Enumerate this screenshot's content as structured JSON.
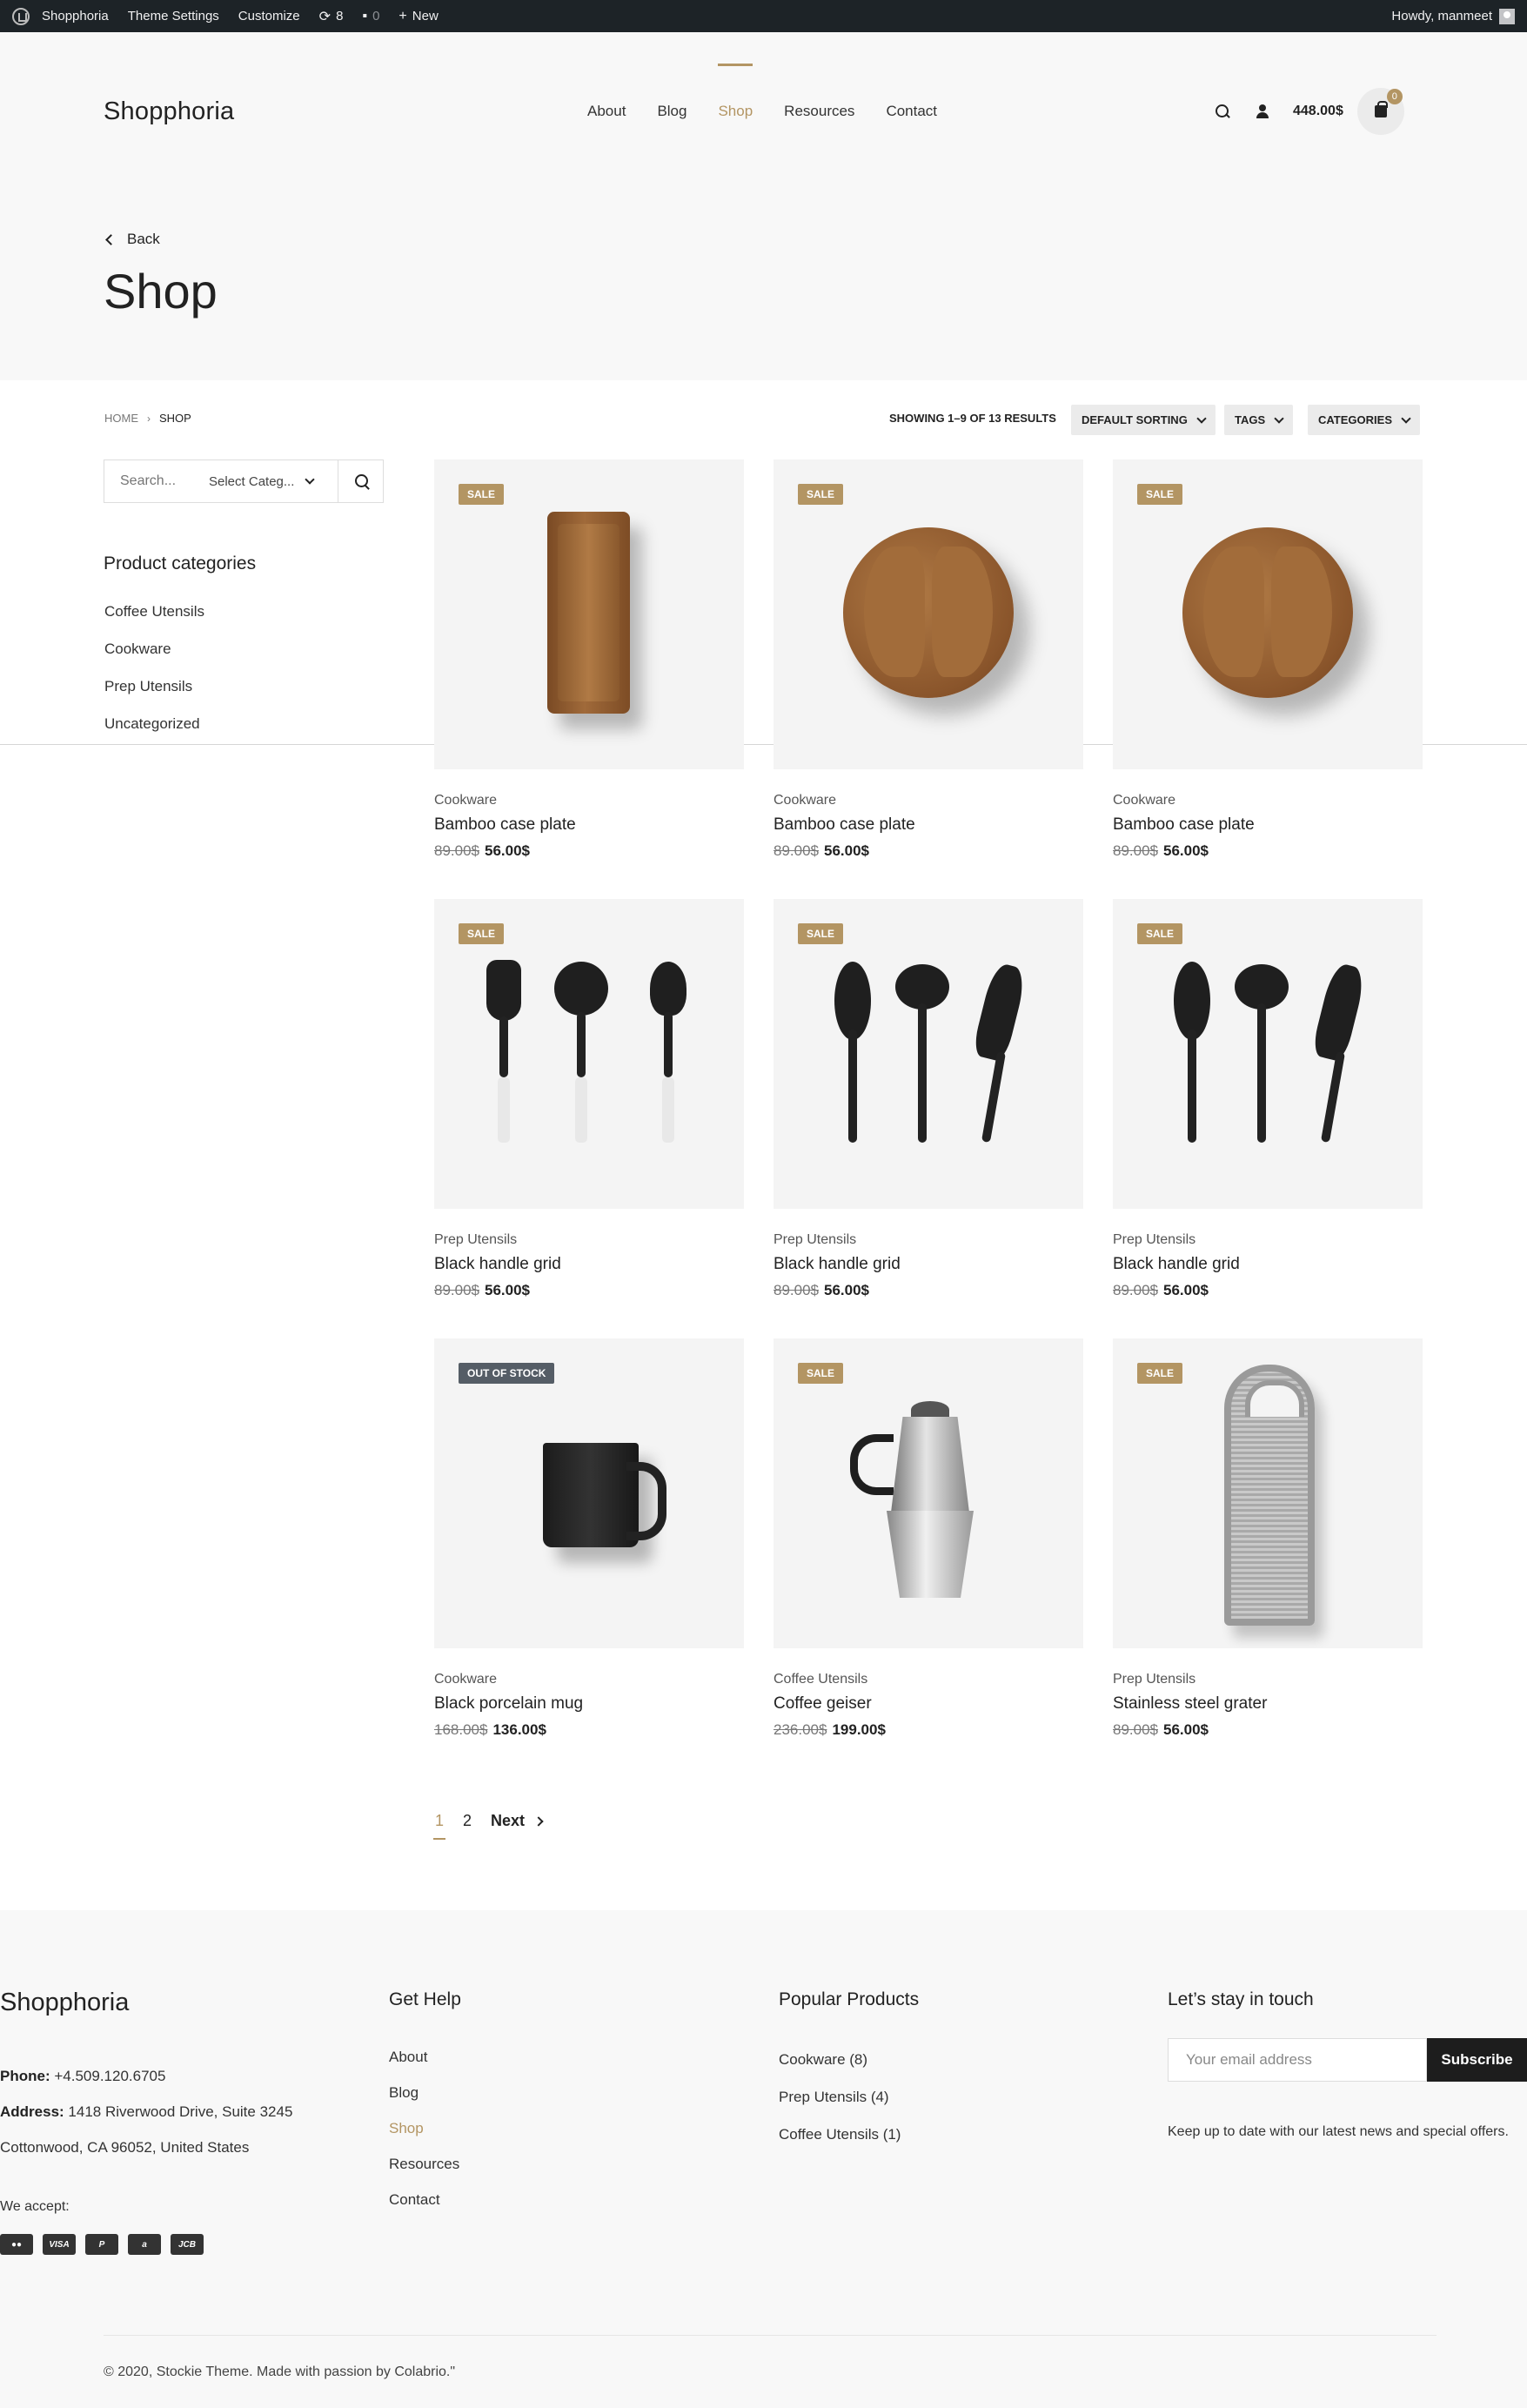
{
  "adminbar": {
    "site": "Shopphoria",
    "theme_settings": "Theme Settings",
    "customize": "Customize",
    "updates_count": "8",
    "comments_count": "0",
    "new_label": "New",
    "howdy": "Howdy, manmeet"
  },
  "header": {
    "logo": "Shopphoria",
    "nav": [
      "About",
      "Blog",
      "Shop",
      "Resources",
      "Contact"
    ],
    "active_nav": "Shop",
    "cart_total": "448.00$",
    "cart_count": "0"
  },
  "page": {
    "back_label": "Back",
    "title": "Shop"
  },
  "toolbar": {
    "breadcrumb": [
      "HOME",
      "SHOP"
    ],
    "results": "SHOWING 1–9 OF 13 RESULTS",
    "sorting": "DEFAULT SORTING",
    "tags": "TAGS",
    "categories": "CATEGORIES"
  },
  "sidebar": {
    "search_placeholder": "Search...",
    "category_select": "Select Categ...",
    "title": "Product categories",
    "categories": [
      "Coffee Utensils",
      "Cookware",
      "Prep Utensils",
      "Uncategorized"
    ]
  },
  "products": [
    {
      "badge": "SALE",
      "category": "Cookware",
      "title": "Bamboo case plate",
      "old_price": "89.00$",
      "price": "56.00$",
      "image": "wooden-tray"
    },
    {
      "badge": "SALE",
      "category": "Cookware",
      "title": "Bamboo case plate",
      "old_price": "89.00$",
      "price": "56.00$",
      "image": "wooden-bowl"
    },
    {
      "badge": "SALE",
      "category": "Cookware",
      "title": "Bamboo case plate",
      "old_price": "89.00$",
      "price": "56.00$",
      "image": "wooden-bowl"
    },
    {
      "badge": "SALE",
      "category": "Prep Utensils",
      "title": "Black handle grid",
      "old_price": "89.00$",
      "price": "56.00$",
      "image": "utensils-white-handle"
    },
    {
      "badge": "SALE",
      "category": "Prep Utensils",
      "title": "Black handle grid",
      "old_price": "89.00$",
      "price": "56.00$",
      "image": "utensils-black"
    },
    {
      "badge": "SALE",
      "category": "Prep Utensils",
      "title": "Black handle grid",
      "old_price": "89.00$",
      "price": "56.00$",
      "image": "utensils-black"
    },
    {
      "badge": "OUT OF STOCK",
      "category": "Cookware",
      "title": "Black porcelain mug",
      "old_price": "168.00$",
      "price": "136.00$",
      "image": "black-mug"
    },
    {
      "badge": "SALE",
      "category": "Coffee Utensils",
      "title": "Coffee geiser",
      "old_price": "236.00$",
      "price": "199.00$",
      "image": "moka-pot"
    },
    {
      "badge": "SALE",
      "category": "Prep Utensils",
      "title": "Stainless steel grater",
      "old_price": "89.00$",
      "price": "56.00$",
      "image": "grater"
    }
  ],
  "pagination": {
    "pages": [
      "1",
      "2"
    ],
    "current": "1",
    "next": "Next"
  },
  "footer": {
    "logo": "Shopphoria",
    "phone_label": "Phone:",
    "phone": "+4.509.120.6705",
    "address_label": "Address:",
    "address_line1": "1418 Riverwood Drive, Suite 3245",
    "address_line2": "Cottonwood, CA 96052, United States",
    "we_accept": "We accept:",
    "payments": [
      "mastercard-icon",
      "visa-icon",
      "paypal-icon",
      "amazon-icon",
      "jcb-icon"
    ],
    "payment_labels": [
      "",
      "VISA",
      "P",
      "a",
      "JCB"
    ],
    "help_title": "Get Help",
    "help_links": [
      "About",
      "Blog",
      "Shop",
      "Resources",
      "Contact"
    ],
    "popular_title": "Popular Products",
    "popular_links": [
      "Cookware (8)",
      "Prep Utensils (4)",
      "Coffee Utensils (1)"
    ],
    "touch_title": "Let’s stay in touch",
    "email_placeholder": "Your email address",
    "subscribe": "Subscribe",
    "note": "Keep up to date with our latest news and special offers.",
    "copyright": "© 2020, Stockie Theme. Made with passion by Colabrio.\""
  },
  "colors": {
    "accent": "#b39563",
    "adminbar": "#1d2327",
    "badge_out": "#555d66"
  }
}
